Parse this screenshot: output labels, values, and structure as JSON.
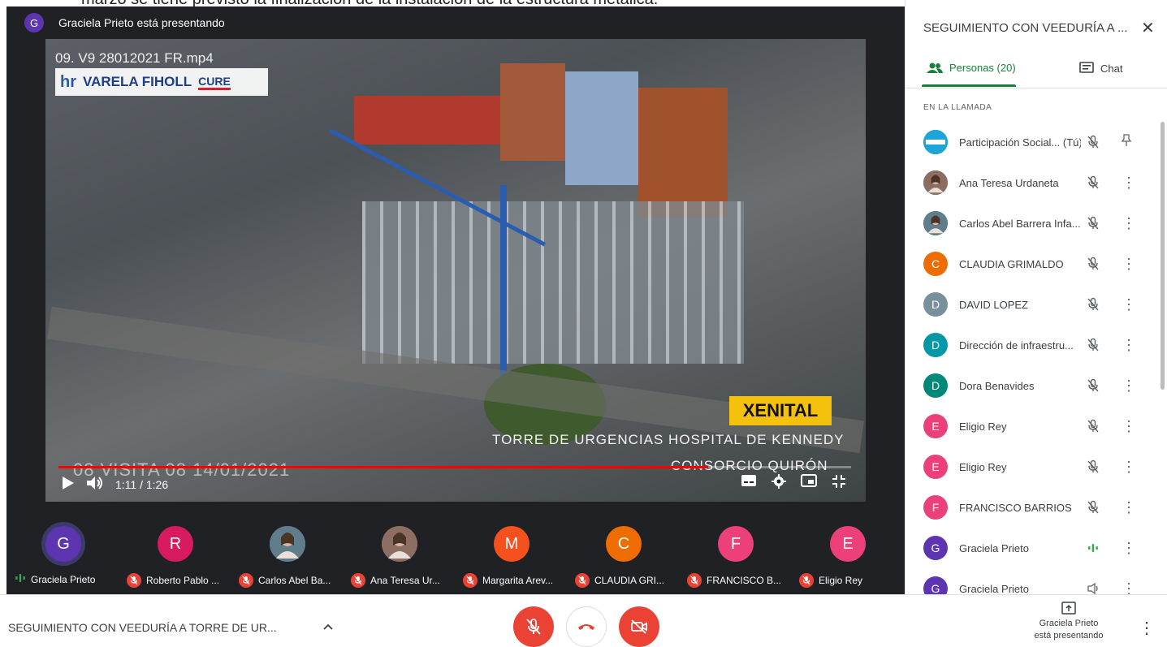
{
  "caption": "marzo se tiene previsto la finalización de la instalación de la estructura metálica.",
  "presenter": {
    "initial": "G",
    "text": "Graciela Prieto está presentando",
    "color": "#5e35b1"
  },
  "video": {
    "file_title": "09. V9 28012021 FR.mp4",
    "logo_left": "hr",
    "logo_mid": "VARELA FIHOLL",
    "logo_right": "CURE",
    "xenital": "XENITAL",
    "tagline1": "TORRE DE URGENCIAS HOSPITAL DE KENNEDY",
    "tagline2": "CONSORCIO QUIRÓN",
    "visita": "08 VISITA 08 14/01/2021",
    "time": "1:11 / 1:26",
    "progress": 0.82
  },
  "filmstrip": [
    {
      "initial": "G",
      "name": "Graciela Prieto",
      "color": "#5e35b1",
      "speaking": true,
      "photo": false
    },
    {
      "initial": "R",
      "name": "Roberto Pablo ...",
      "color": "#d81b60",
      "speaking": false,
      "photo": false
    },
    {
      "initial": "",
      "name": "Carlos Abel Ba...",
      "color": "#607d8b",
      "speaking": false,
      "photo": true
    },
    {
      "initial": "",
      "name": "Ana Teresa Ur...",
      "color": "#8d6e63",
      "speaking": false,
      "photo": true
    },
    {
      "initial": "M",
      "name": "Margarita Arev...",
      "color": "#f4511e",
      "speaking": false,
      "photo": false
    },
    {
      "initial": "C",
      "name": "CLAUDIA GRI...",
      "color": "#ef6c00",
      "speaking": false,
      "photo": false
    },
    {
      "initial": "F",
      "name": "FRANCISCO B...",
      "color": "#ec407a",
      "speaking": false,
      "photo": false
    },
    {
      "initial": "E",
      "name": "Eligio Rey",
      "color": "#ec407a",
      "speaking": false,
      "photo": false
    }
  ],
  "panel": {
    "title": "SEGUIMIENTO CON VEEDURÍA A ...",
    "tab_people": "Personas (20)",
    "tab_chat": "Chat",
    "section": "EN LA LLAMADA",
    "people": [
      {
        "initial": "",
        "name": "Participación Social... (Tú)",
        "color": "#1ea4d8",
        "status": "muted",
        "action": "pin"
      },
      {
        "initial": "",
        "name": "Ana Teresa Urdaneta",
        "color": "#8d6e63",
        "status": "muted",
        "action": "more"
      },
      {
        "initial": "",
        "name": "Carlos Abel Barrera Infa...",
        "color": "#607d8b",
        "status": "muted",
        "action": "more"
      },
      {
        "initial": "C",
        "name": "CLAUDIA GRIMALDO",
        "color": "#ef6c00",
        "status": "muted",
        "action": "more"
      },
      {
        "initial": "D",
        "name": "DAVID LOPEZ",
        "color": "#78909c",
        "status": "muted",
        "action": "more"
      },
      {
        "initial": "D",
        "name": "Dirección de infraestru...",
        "color": "#0097a7",
        "status": "muted",
        "action": "more"
      },
      {
        "initial": "D",
        "name": "Dora Benavides",
        "color": "#00897b",
        "status": "muted",
        "action": "more"
      },
      {
        "initial": "E",
        "name": "Eligio Rey",
        "color": "#ec407a",
        "status": "muted",
        "action": "more"
      },
      {
        "initial": "E",
        "name": "Eligio Rey",
        "color": "#ec407a",
        "status": "muted",
        "action": "more"
      },
      {
        "initial": "F",
        "name": "FRANCISCO BARRIOS",
        "color": "#ec407a",
        "status": "muted",
        "action": "more"
      },
      {
        "initial": "G",
        "name": "Graciela Prieto",
        "color": "#5e35b1",
        "status": "speaking",
        "action": "more"
      },
      {
        "initial": "G",
        "name": "Graciela Prieto",
        "color": "#5e35b1",
        "status": "presenting",
        "action": "more"
      }
    ]
  },
  "bottom": {
    "meeting_title": "SEGUIMIENTO CON VEEDURÍA A TORRE DE UR...",
    "present_line1": "Graciela Prieto",
    "present_line2": "está presentando"
  }
}
